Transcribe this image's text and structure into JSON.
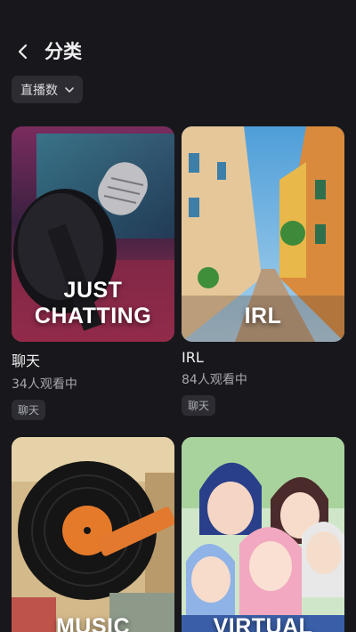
{
  "header": {
    "title": "分类"
  },
  "sort": {
    "label": "直播数"
  },
  "categories": [
    {
      "thumb_text": "JUST\nCHATTING",
      "name": "聊天",
      "viewers": "34人观看中",
      "tag": "聊天"
    },
    {
      "thumb_text": "IRL",
      "name": "IRL",
      "viewers": "84人观看中",
      "tag": "聊天"
    },
    {
      "thumb_text": "MUSIC"
    },
    {
      "thumb_text": "VIRTUAL"
    }
  ],
  "colors": {
    "background": "#18181c",
    "chip": "#2c2c32",
    "text": "#efeff1",
    "muted": "#a6a6ad"
  }
}
